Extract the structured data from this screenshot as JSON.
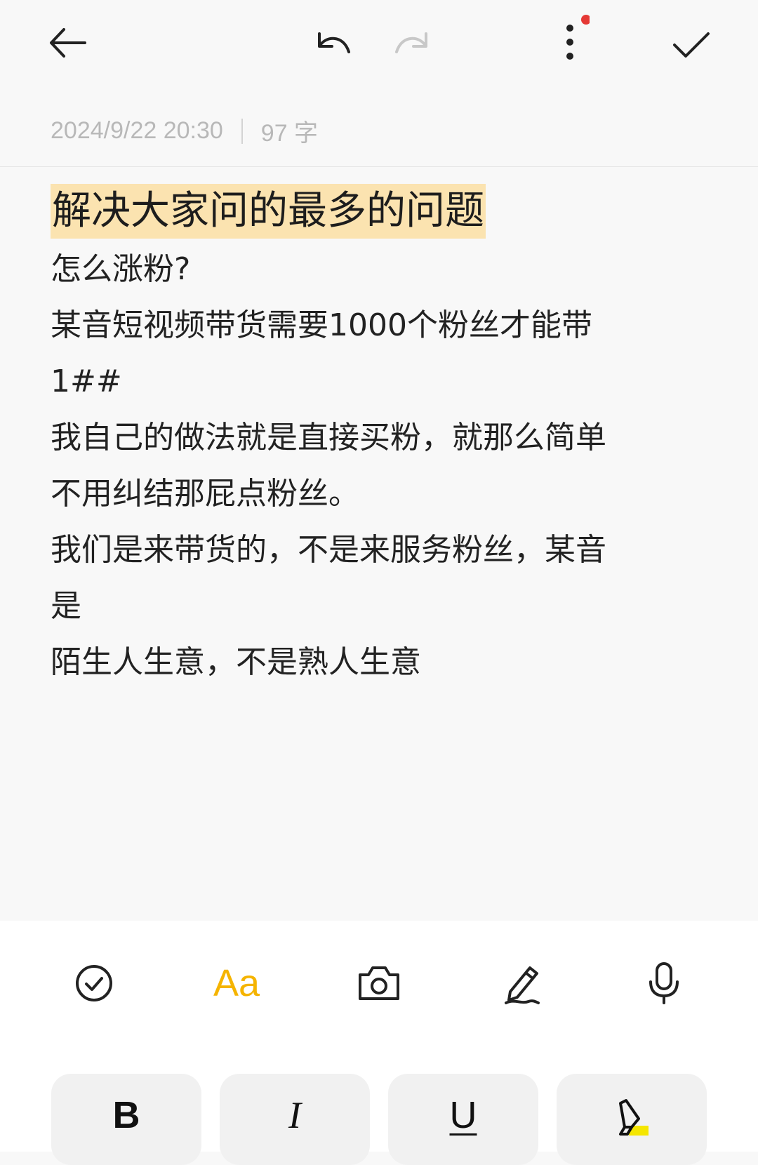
{
  "header": {
    "icons": {
      "back": "arrow-left-icon",
      "undo": "undo-icon",
      "redo": "redo-icon",
      "more": "more-vertical-icon",
      "done": "check-icon"
    },
    "notification_dot_color": "#e53935"
  },
  "note": {
    "date": "2024/9/22 20:30",
    "word_count": "97 字",
    "title": "解决大家问的最多的问题",
    "title_highlight_color": "#fbe3b0",
    "lines": [
      "怎么涨粉?",
      "某音短视频带货需要1000个粉丝才能带",
      "1##",
      "我自己的做法就是直接买粉，就那么简单",
      "不用纠结那屁点粉丝。",
      "我们是来带货的，不是来服务粉丝，某音",
      "是",
      "陌生人生意，不是熟人生意"
    ]
  },
  "toolbar": {
    "checklist_icon": "checklist-icon",
    "text_format_label": "Aa",
    "accent_color": "#f5b400",
    "camera_icon": "camera-icon",
    "handwriting_icon": "pen-icon",
    "voice_icon": "microphone-icon"
  },
  "format_bar": {
    "bold_label": "B",
    "italic_label": "I",
    "underline_label": "U",
    "highlight_icon": "highlighter-icon",
    "highlight_color": "#f5e600"
  }
}
